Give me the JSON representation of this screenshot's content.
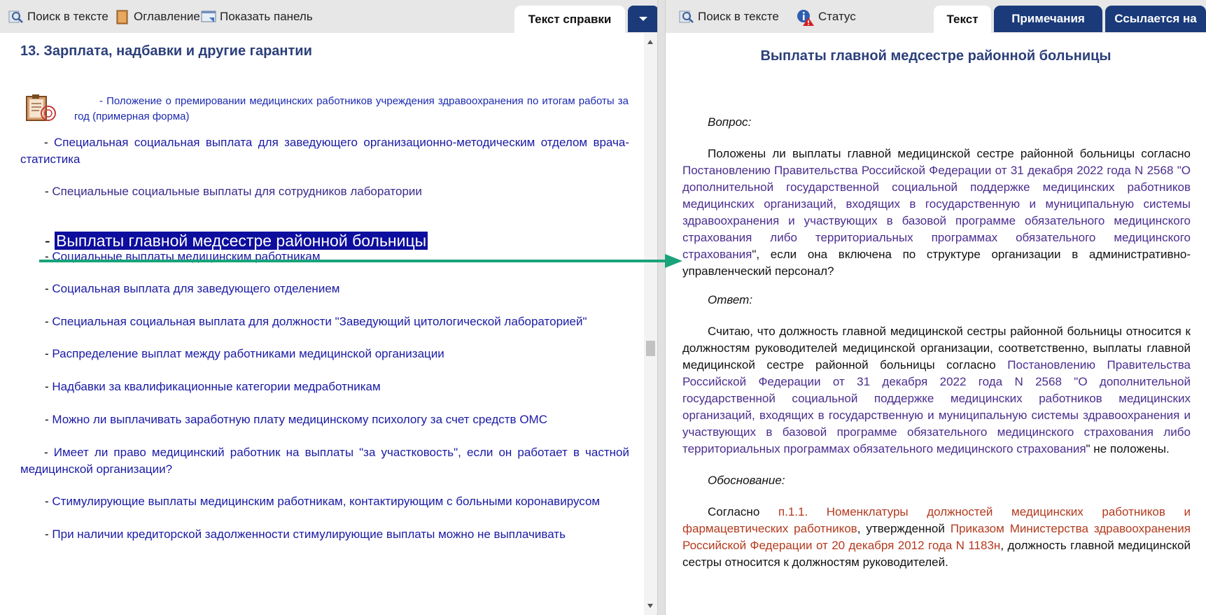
{
  "left_toolbar": {
    "search_label": "Поиск в тексте",
    "toc_label": "Оглавление",
    "panel_label": "Показать панель",
    "tab_label": "Текст справки"
  },
  "left": {
    "section_title": "13. Зарплата, надбавки и другие гарантии",
    "form_link_dash": "- ",
    "form_link": "Положение о премировании медицинских работников учреждения здравоохранения по итогам работы за год (примерная форма)",
    "items": [
      {
        "dash": "- ",
        "text": "Специальная социальная выплата для заведующего организационно-методическим отделом врача-статистика"
      },
      {
        "dash": "- ",
        "text": "Специальные социальные выплаты для сотрудников лаборатории"
      },
      {
        "dash": "- ",
        "text": "Выплаты главной медсестре районной больницы"
      },
      {
        "dash": "- ",
        "text": "Социальные выплаты медицинским работникам"
      },
      {
        "dash": "- ",
        "text": "Социальная выплата для заведующего отделением"
      },
      {
        "dash": "- ",
        "text": "Специальная социальная выплата для должности \"Заведующий цитологической лабораторией\""
      },
      {
        "dash": "- ",
        "text": "Распределение выплат между работниками медицинской организации"
      },
      {
        "dash": "- ",
        "text": "Надбавки за квалификационные категории медработникам"
      },
      {
        "dash": "- ",
        "text": "Можно ли выплачивать заработную плату медицинскому психологу за счет средств ОМС"
      },
      {
        "dash": "- ",
        "text": "Имеет ли право медицинский работник на выплаты \"за участковость\", если он работает в частной медицинской организации?"
      },
      {
        "dash": "- ",
        "text": "Стимулирующие выплаты медицинским работникам, контактирующим с больными коронавирусом"
      },
      {
        "dash": "- ",
        "text": "При наличии кредиторской задолженности стимулирующие выплаты можно не выплачивать"
      }
    ]
  },
  "right_toolbar": {
    "search_label": "Поиск в тексте",
    "status_label": "Статус",
    "tab_text": "Текст",
    "tab_notes": "Примечания",
    "tab_refers": "Ссылается на"
  },
  "right": {
    "title": "Выплаты главной медсестре районной больницы",
    "question_label": "Вопрос",
    "q_text_start": "Положены ли выплаты главной медицинской сестре районной больницы согласно ",
    "q_link": "Постановлению Правительства Российской Федерации от 31 декабря 2022 года N 2568 \"О дополнительной государственной социальной поддержке медицинских работников медицинских организаций, входящих в государственную и муниципальную системы здравоохранения и участвующих в базовой программе обязательного медицинского страхования либо территориальных программах обязательного медицинского страхования",
    "q_text_end": "\", если она включена по структуре организации в административно-управленческий персонал?",
    "answer_label": "Ответ",
    "a_text_start": "Считаю, что должность главной медицинской сестры районной больницы относится к должностям руководителей медицинской организации, соответственно, выплаты главной медицинской сестре районной больницы согласно ",
    "a_link": "Постановлению Правительства Российской Федерации от 31 декабря 2022 года N 2568 \"О дополнительной государственной социальной поддержке медицинских работников медицинских организаций, входящих в государственную и муниципальную системы здравоохранения и участвующих в базовой программе обязательного медицинского страхования либо территориальных программах обязательного медицинского страхования",
    "a_text_end": "\" не положены.",
    "basis_label": "Обоснование",
    "b_text_start": "Согласно ",
    "b_link1": "п.1.1. Номенклатуры должностей медицинских работников и фармацевтических работников",
    "b_text_mid": ", утвержденной ",
    "b_link2": "Приказом Министерства здравоохранения Российской Федерации от 20 декабря 2012 года N 1183н",
    "b_text_end": ", должность главной медицинской сестры относится к должностям руководителей."
  },
  "colors": {
    "link": "#1a1aa6",
    "visited_link": "#4b2d8f",
    "external_link": "#b33a1d",
    "heading": "#2b3f7a",
    "tab_dark": "#1a3a7a",
    "selection": "#0d0d9e",
    "arrow": "#1aa37a"
  },
  "icons": [
    "search-icon",
    "book-icon",
    "panel-icon",
    "chevron-down-icon",
    "status-info-icon",
    "document-stamp-icon"
  ]
}
